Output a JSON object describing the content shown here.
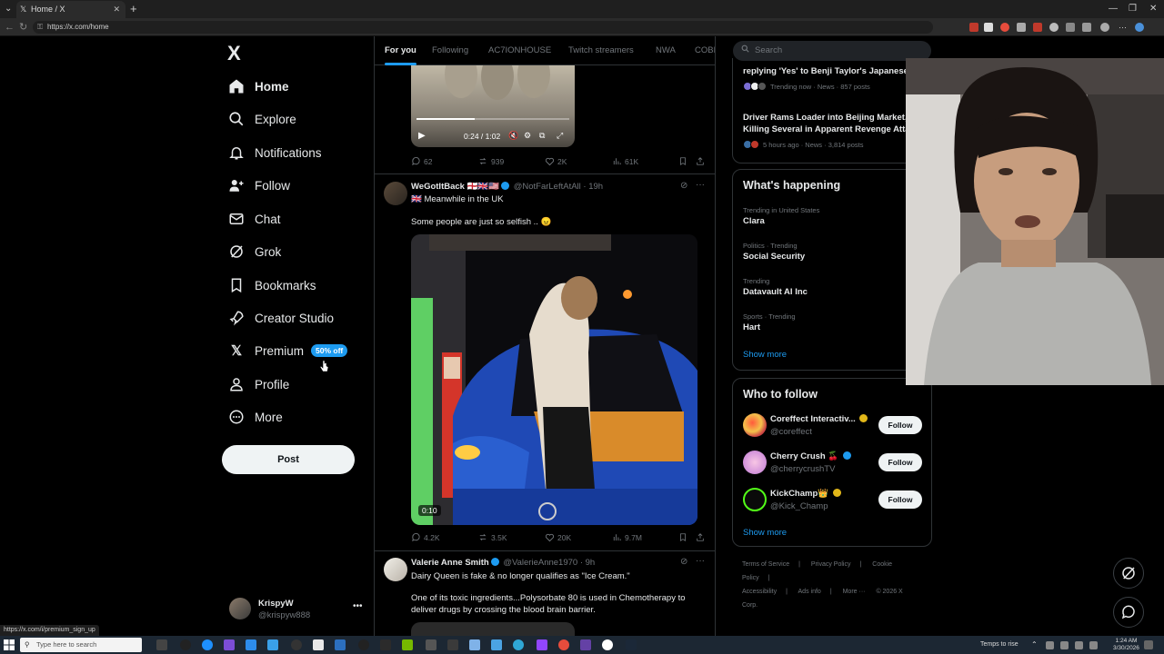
{
  "browser": {
    "tab_title": "Home / X",
    "url": "https://x.com/home",
    "status_link": "https://x.com/i/premium_sign_up"
  },
  "sidebar": {
    "logo": "X",
    "items": [
      {
        "label": "Home",
        "icon": "home-icon"
      },
      {
        "label": "Explore",
        "icon": "search-icon"
      },
      {
        "label": "Notifications",
        "icon": "bell-icon"
      },
      {
        "label": "Follow",
        "icon": "person-plus-icon"
      },
      {
        "label": "Chat",
        "icon": "mail-icon"
      },
      {
        "label": "Grok",
        "icon": "grok-icon"
      },
      {
        "label": "Bookmarks",
        "icon": "bookmark-icon"
      },
      {
        "label": "Creator Studio",
        "icon": "rocket-icon"
      },
      {
        "label": "Premium",
        "icon": "x-logo-icon"
      },
      {
        "label": "Profile",
        "icon": "person-icon"
      },
      {
        "label": "More",
        "icon": "more-circle-icon"
      }
    ],
    "premium_badge": "50% off",
    "post_label": "Post",
    "account": {
      "name": "KrispyW",
      "handle": "@krispyw888"
    }
  },
  "feed": {
    "tabs": [
      "For you",
      "Following",
      "AC7IONHOUSE",
      "Twitch streamers",
      "NWA",
      "COBE"
    ],
    "video1": {
      "time": "0:24 / 1:02",
      "progress": 0.38
    },
    "post1_stats": {
      "replies": "62",
      "reposts": "939",
      "likes": "2K",
      "views": "61K"
    },
    "post2": {
      "name": "WeGotItBack 🏴󠁧󠁢󠁥󠁮󠁧󠁿🇬🇧🇺🇸",
      "handle": "@NotFarLeftAtAll",
      "time": "· 19h",
      "line1": "🇬🇧 Meanwhile in the UK",
      "line2": "Some people are just so selfish .. 😠",
      "video_duration": "0:10",
      "stats": {
        "replies": "4.2K",
        "reposts": "3.5K",
        "likes": "20K",
        "views": "9.7M"
      }
    },
    "post3": {
      "name": "Valerie Anne Smith",
      "handle": "@ValerieAnne1970",
      "time": "· 9h",
      "line1": "Dairy Queen is fake & no longer qualifies as \"Ice Cream.\"",
      "line2": "One of its toxic ingredients...Polysorbate 80 is used in Chemotherapy to deliver drugs by crossing the blood brain barrier."
    }
  },
  "right": {
    "search_placeholder": "Search",
    "news": [
      {
        "title": "replying 'Yes' to Benji Taylor's Japanese",
        "meta": "Trending now · News · 857 posts"
      },
      {
        "title": "Driver Rams Loader into Beijing Market,",
        "title2": "Killing Several in Apparent Revenge Atta",
        "meta": "5 hours ago · News · 3,814 posts"
      }
    ],
    "happening_title": "What's happening",
    "trends": [
      {
        "meta": "Trending in United States",
        "name": "Clara"
      },
      {
        "meta": "Politics · Trending",
        "name": "Social Security"
      },
      {
        "meta": "Trending",
        "name": "Datavault AI Inc"
      },
      {
        "meta": "Sports · Trending",
        "name": "Hart"
      }
    ],
    "show_more": "Show more",
    "wtf_title": "Who to follow",
    "wtf": [
      {
        "name": "Coreffect Interactiv...",
        "handle": "@coreffect",
        "verified": "gold"
      },
      {
        "name": "Cherry Crush 🍒",
        "handle": "@cherrycrushTV",
        "verified": "blue"
      },
      {
        "name": "KickChamp👑",
        "handle": "@Kick_Champ",
        "verified": "gold"
      }
    ],
    "follow_label": "Follow",
    "footer": [
      "Terms of Service",
      "|",
      "Privacy Policy",
      "|",
      "Cookie Policy",
      "|",
      "Accessibility",
      "|",
      "Ads info",
      "|",
      "More ···",
      "© 2026 X Corp."
    ]
  },
  "taskbar": {
    "search_placeholder": "Type here to search",
    "weather": "Temps to rise",
    "time": "1:24 AM",
    "date": "3/30/2026"
  },
  "colors": {
    "accent": "#1d9bf0",
    "background": "#000000",
    "border": "#2f3336",
    "muted": "#71767b"
  }
}
